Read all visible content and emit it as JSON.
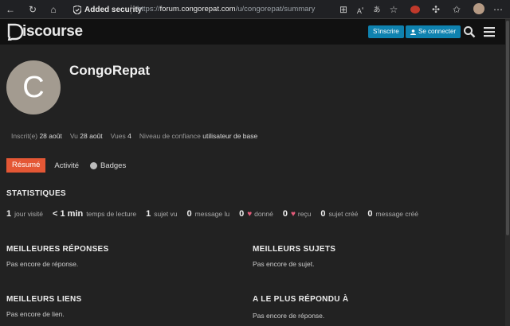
{
  "browser": {
    "security_label": "Added security",
    "url_prefix": "https://",
    "url_domain": "forum.congorepat.com",
    "url_path": "/u/congorepat/summary",
    "icons": [
      "back-icon",
      "refresh-icon",
      "home-icon",
      "shield-icon",
      "grid-icon",
      "read-aloud-icon",
      "translate-icon",
      "favorite-add-icon",
      "extension-icon",
      "puzzle-icon",
      "favorites-icon",
      "collections-icon",
      "profile-icon"
    ]
  },
  "header": {
    "logo_text": "iscourse",
    "signup_label": "S'inscrire",
    "login_label": "Se connecter",
    "icons": [
      "search-icon",
      "hamburger-icon"
    ]
  },
  "profile": {
    "avatar_letter": "C",
    "avatar_color": "#a39b90",
    "name": "CongoRepat",
    "joined_label": "Inscrit(e)",
    "joined_value": "28 août",
    "seen_label": "Vu",
    "seen_value": "28 août",
    "views_label": "Vues",
    "views_value": "4",
    "trust_label": "Niveau de confiance",
    "trust_value": "utilisateur de base"
  },
  "tabs": {
    "summary": "Résumé",
    "activity": "Activité",
    "badges": "Badges"
  },
  "stats": {
    "title": "STATISTIQUES",
    "items": [
      {
        "num": "1",
        "label": "jour visité"
      },
      {
        "num": "< 1 min",
        "label": "temps de lecture"
      },
      {
        "num": "1",
        "label": "sujet vu"
      },
      {
        "num": "0",
        "label": "message lu"
      },
      {
        "num": "0",
        "label": "donné"
      },
      {
        "num": "0",
        "label": "reçu"
      },
      {
        "num": "0",
        "label": "sujet créé"
      },
      {
        "num": "0",
        "label": "message créé"
      }
    ]
  },
  "sections": {
    "top_replies_title": "MEILLEURES RÉPONSES",
    "top_replies_empty": "Pas encore de réponse.",
    "top_topics_title": "MEILLEURS SUJETS",
    "top_topics_empty": "Pas encore de sujet.",
    "top_links_title": "MEILLEURS LIENS",
    "top_links_empty": "Pas encore de lien.",
    "most_replied_title": "A LE PLUS RÉPONDU À",
    "most_replied_empty": "Pas encore de réponse."
  },
  "colors": {
    "accent": "#e45735",
    "button": "#0f82af",
    "heart": "#e45b7a",
    "background": "#222222"
  }
}
